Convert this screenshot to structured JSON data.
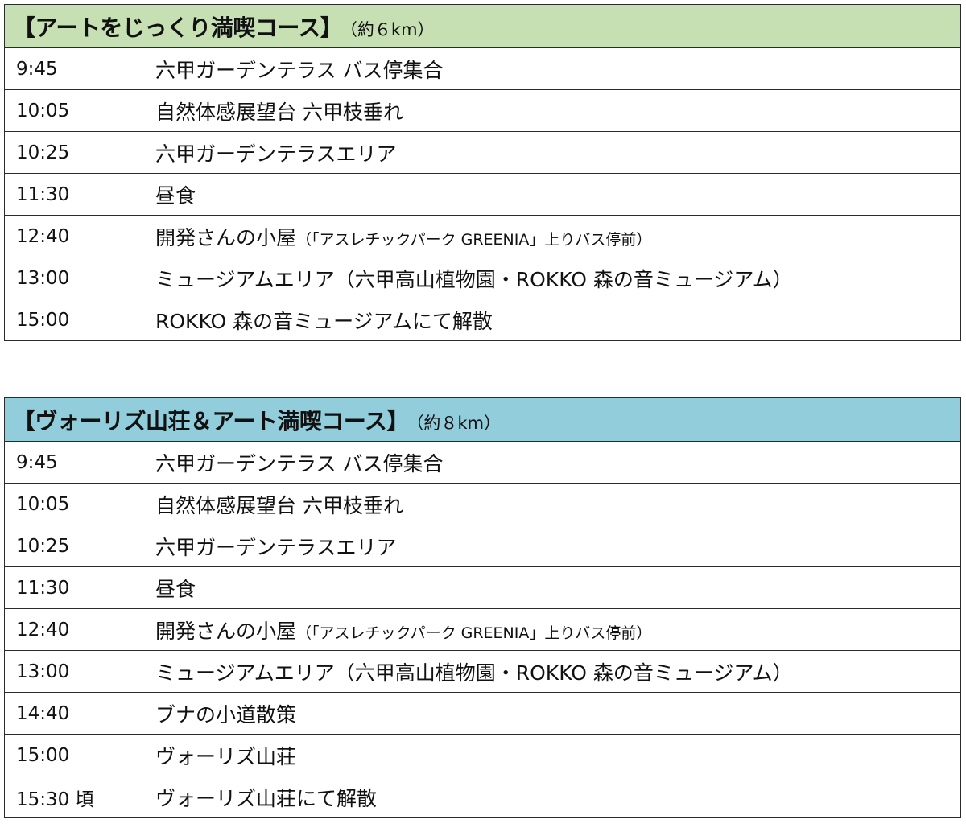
{
  "courses": [
    {
      "title": "【アートをじっくり満喫コース】",
      "distance": "（約６km）",
      "rows": [
        {
          "time": "9:45",
          "place": "六甲ガーデンテラス バス停集合",
          "note": ""
        },
        {
          "time": "10:05",
          "place": "自然体感展望台 六甲枝垂れ",
          "note": ""
        },
        {
          "time": "10:25",
          "place": "六甲ガーデンテラスエリア",
          "note": ""
        },
        {
          "time": "11:30",
          "place": "昼食",
          "note": ""
        },
        {
          "time": "12:40",
          "place": "開発さんの小屋",
          "note": "（「アスレチックパーク GREENIA」上りバス停前）"
        },
        {
          "time": "13:00",
          "place": "ミュージアムエリア（六甲高山植物園・ROKKO 森の音ミュージアム）",
          "note": ""
        },
        {
          "time": "15:00",
          "place": "ROKKO 森の音ミュージアムにて解散",
          "note": ""
        }
      ]
    },
    {
      "title": "【ヴォーリズ山荘＆アート満喫コース】",
      "distance": "（約８km）",
      "rows": [
        {
          "time": "9:45",
          "place": "六甲ガーデンテラス バス停集合",
          "note": ""
        },
        {
          "time": "10:05",
          "place": "自然体感展望台 六甲枝垂れ",
          "note": ""
        },
        {
          "time": "10:25",
          "place": "六甲ガーデンテラスエリア",
          "note": ""
        },
        {
          "time": "11:30",
          "place": "昼食",
          "note": ""
        },
        {
          "time": "12:40",
          "place": "開発さんの小屋",
          "note": "（「アスレチックパーク GREENIA」上りバス停前）"
        },
        {
          "time": "13:00",
          "place": "ミュージアムエリア（六甲高山植物園・ROKKO 森の音ミュージアム）",
          "note": ""
        },
        {
          "time": "14:40",
          "place": "ブナの小道散策",
          "note": ""
        },
        {
          "time": "15:00",
          "place": "ヴォーリズ山荘",
          "note": ""
        },
        {
          "time": "15:30 頃",
          "place": "ヴォーリズ山荘にて解散",
          "note": ""
        }
      ]
    }
  ],
  "colors": {
    "course1_header": "#c6e0b4",
    "course2_header": "#92cddc",
    "border": "#2b2b2b"
  }
}
